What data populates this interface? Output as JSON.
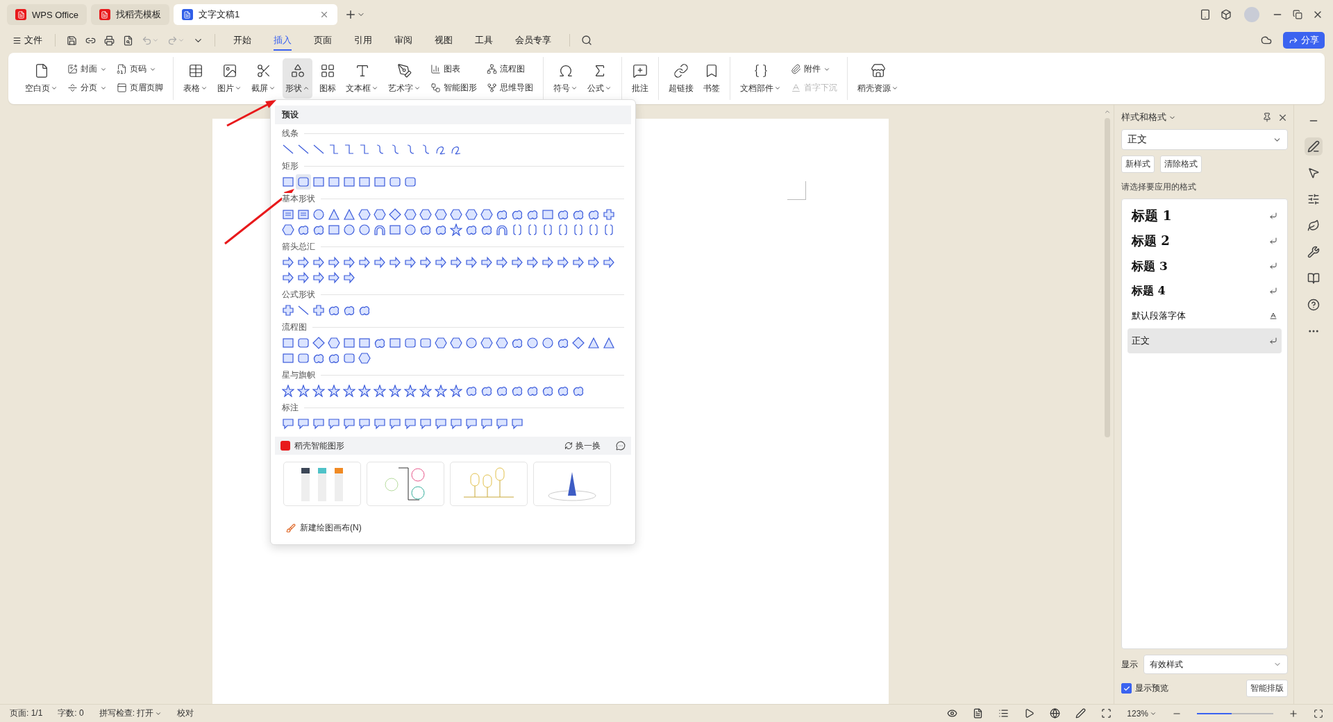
{
  "tabs": [
    {
      "label": "WPS Office",
      "kind": "home",
      "selected": false
    },
    {
      "label": "找稻壳模板",
      "kind": "docer",
      "selected": false
    },
    {
      "label": "文字文稿1",
      "kind": "doc",
      "selected": true
    }
  ],
  "menu": {
    "file": "文件",
    "tabs": [
      {
        "label": "开始",
        "selected": false
      },
      {
        "label": "插入",
        "selected": true
      },
      {
        "label": "页面",
        "selected": false
      },
      {
        "label": "引用",
        "selected": false
      },
      {
        "label": "审阅",
        "selected": false
      },
      {
        "label": "视图",
        "selected": false
      },
      {
        "label": "工具",
        "selected": false
      },
      {
        "label": "会员专享",
        "selected": false
      }
    ],
    "share": "分享"
  },
  "ribbon": [
    {
      "items": [
        {
          "kind": "large",
          "label": "空白页",
          "caret": true,
          "open": false
        },
        {
          "kind": "stack",
          "items": [
            {
              "label": "封面",
              "caret": true,
              "disabled": false
            },
            {
              "label": "分页",
              "caret": true,
              "disabled": false
            }
          ]
        },
        {
          "kind": "stack",
          "items": [
            {
              "label": "页码",
              "caret": true,
              "disabled": false
            },
            {
              "label": "页眉页脚",
              "caret": false,
              "disabled": false
            }
          ]
        }
      ]
    },
    {
      "items": [
        {
          "kind": "large",
          "label": "表格",
          "caret": true,
          "open": false
        },
        {
          "kind": "large",
          "label": "图片",
          "caret": true,
          "open": false
        },
        {
          "kind": "large",
          "label": "截屏",
          "caret": true,
          "open": false
        },
        {
          "kind": "large",
          "label": "形状",
          "caret": true,
          "open": true
        },
        {
          "kind": "large",
          "label": "图标",
          "caret": false,
          "open": false
        },
        {
          "kind": "large",
          "label": "文本框",
          "caret": true,
          "open": false
        },
        {
          "kind": "large",
          "label": "艺术字",
          "caret": true,
          "open": false
        },
        {
          "kind": "stack",
          "items": [
            {
              "label": "图表",
              "caret": false,
              "disabled": false
            },
            {
              "label": "智能图形",
              "caret": false,
              "disabled": false
            }
          ]
        },
        {
          "kind": "stack",
          "items": [
            {
              "label": "流程图",
              "caret": false,
              "disabled": false
            },
            {
              "label": "思维导图",
              "caret": false,
              "disabled": false
            }
          ]
        }
      ]
    },
    {
      "items": [
        {
          "kind": "large",
          "label": "符号",
          "caret": true,
          "open": false
        },
        {
          "kind": "large",
          "label": "公式",
          "caret": true,
          "open": false
        }
      ]
    },
    {
      "items": [
        {
          "kind": "large",
          "label": "批注",
          "caret": false,
          "open": false
        }
      ]
    },
    {
      "items": [
        {
          "kind": "large",
          "label": "超链接",
          "caret": false,
          "open": false
        },
        {
          "kind": "large",
          "label": "书签",
          "caret": false,
          "open": false
        }
      ]
    },
    {
      "items": [
        {
          "kind": "large",
          "label": "文档部件",
          "caret": true,
          "open": false
        },
        {
          "kind": "stack",
          "items": [
            {
              "label": "附件",
              "caret": true,
              "disabled": false
            },
            {
              "label": "首字下沉",
              "caret": false,
              "disabled": true
            }
          ]
        }
      ]
    },
    {
      "items": [
        {
          "kind": "large",
          "label": "稻壳资源",
          "caret": true,
          "open": false
        }
      ]
    }
  ],
  "shape_menu": {
    "title": "预设",
    "sections": [
      {
        "title": "线条",
        "shapes": [
          {
            "selected": false
          },
          {
            "selected": false
          },
          {
            "selected": false
          },
          {
            "selected": false
          },
          {
            "selected": false
          },
          {
            "selected": false
          },
          {
            "selected": false
          },
          {
            "selected": false
          },
          {
            "selected": false
          },
          {
            "selected": false
          },
          {
            "selected": false
          },
          {
            "selected": false
          }
        ]
      },
      {
        "title": "矩形",
        "shapes": [
          {
            "selected": false
          },
          {
            "selected": true
          },
          {
            "selected": false
          },
          {
            "selected": false
          },
          {
            "selected": false
          },
          {
            "selected": false
          },
          {
            "selected": false
          },
          {
            "selected": false
          },
          {
            "selected": false
          }
        ]
      },
      {
        "title": "基本形状",
        "shapes": [
          {
            "selected": false
          },
          {
            "selected": false
          },
          {
            "selected": false
          },
          {
            "selected": false
          },
          {
            "selected": false
          },
          {
            "selected": false
          },
          {
            "selected": false
          },
          {
            "selected": false
          },
          {
            "selected": false
          },
          {
            "selected": false
          },
          {
            "selected": false
          },
          {
            "selected": false
          },
          {
            "selected": false
          },
          {
            "selected": false
          },
          {
            "selected": false
          },
          {
            "selected": false
          },
          {
            "selected": false
          },
          {
            "selected": false
          },
          {
            "selected": false
          },
          {
            "selected": false
          },
          {
            "selected": false
          },
          {
            "selected": false
          },
          {
            "selected": false
          },
          {
            "selected": false
          },
          {
            "selected": false
          },
          {
            "selected": false
          },
          {
            "selected": false
          },
          {
            "selected": false
          },
          {
            "selected": false
          },
          {
            "selected": false
          },
          {
            "selected": false
          },
          {
            "selected": false
          },
          {
            "selected": false
          },
          {
            "selected": false
          },
          {
            "selected": false
          },
          {
            "selected": false
          },
          {
            "selected": false
          },
          {
            "selected": false
          },
          {
            "selected": false
          },
          {
            "selected": false
          },
          {
            "selected": false
          },
          {
            "selected": false
          },
          {
            "selected": false
          },
          {
            "selected": false
          }
        ]
      },
      {
        "title": "箭头总汇",
        "shapes": [
          {
            "selected": false
          },
          {
            "selected": false
          },
          {
            "selected": false
          },
          {
            "selected": false
          },
          {
            "selected": false
          },
          {
            "selected": false
          },
          {
            "selected": false
          },
          {
            "selected": false
          },
          {
            "selected": false
          },
          {
            "selected": false
          },
          {
            "selected": false
          },
          {
            "selected": false
          },
          {
            "selected": false
          },
          {
            "selected": false
          },
          {
            "selected": false
          },
          {
            "selected": false
          },
          {
            "selected": false
          },
          {
            "selected": false
          },
          {
            "selected": false
          },
          {
            "selected": false
          },
          {
            "selected": false
          },
          {
            "selected": false
          },
          {
            "selected": false
          },
          {
            "selected": false
          },
          {
            "selected": false
          },
          {
            "selected": false
          },
          {
            "selected": false
          }
        ]
      },
      {
        "title": "公式形状",
        "shapes": [
          {
            "selected": false
          },
          {
            "selected": false
          },
          {
            "selected": false
          },
          {
            "selected": false
          },
          {
            "selected": false
          },
          {
            "selected": false
          }
        ]
      },
      {
        "title": "流程图",
        "shapes": [
          {
            "selected": false
          },
          {
            "selected": false
          },
          {
            "selected": false
          },
          {
            "selected": false
          },
          {
            "selected": false
          },
          {
            "selected": false
          },
          {
            "selected": false
          },
          {
            "selected": false
          },
          {
            "selected": false
          },
          {
            "selected": false
          },
          {
            "selected": false
          },
          {
            "selected": false
          },
          {
            "selected": false
          },
          {
            "selected": false
          },
          {
            "selected": false
          },
          {
            "selected": false
          },
          {
            "selected": false
          },
          {
            "selected": false
          },
          {
            "selected": false
          },
          {
            "selected": false
          },
          {
            "selected": false
          },
          {
            "selected": false
          },
          {
            "selected": false
          },
          {
            "selected": false
          },
          {
            "selected": false
          },
          {
            "selected": false
          },
          {
            "selected": false
          },
          {
            "selected": false
          }
        ]
      },
      {
        "title": "星与旗帜",
        "shapes": [
          {
            "selected": false
          },
          {
            "selected": false
          },
          {
            "selected": false
          },
          {
            "selected": false
          },
          {
            "selected": false
          },
          {
            "selected": false
          },
          {
            "selected": false
          },
          {
            "selected": false
          },
          {
            "selected": false
          },
          {
            "selected": false
          },
          {
            "selected": false
          },
          {
            "selected": false
          },
          {
            "selected": false
          },
          {
            "selected": false
          },
          {
            "selected": false
          },
          {
            "selected": false
          },
          {
            "selected": false
          },
          {
            "selected": false
          },
          {
            "selected": false
          },
          {
            "selected": false
          }
        ]
      },
      {
        "title": "标注",
        "shapes": [
          {
            "selected": false
          },
          {
            "selected": false
          },
          {
            "selected": false
          },
          {
            "selected": false
          },
          {
            "selected": false
          },
          {
            "selected": false
          },
          {
            "selected": false
          },
          {
            "selected": false
          },
          {
            "selected": false
          },
          {
            "selected": false
          },
          {
            "selected": false
          },
          {
            "selected": false
          },
          {
            "selected": false
          },
          {
            "selected": false
          },
          {
            "selected": false
          },
          {
            "selected": false
          }
        ]
      }
    ],
    "smart": {
      "title": "稻壳智能图形",
      "refresh": "换一换",
      "thumbnails": [
        {
          "kind": "columns"
        },
        {
          "kind": "mindmap"
        },
        {
          "kind": "timeline"
        },
        {
          "kind": "landmark"
        }
      ]
    },
    "new_canvas": "新建绘图画布(N)"
  },
  "styles_panel": {
    "title": "样式和格式",
    "current": "正文",
    "buttons": [
      "新样式",
      "清除格式"
    ],
    "prompt": "请选择要应用的格式",
    "styles": [
      {
        "label": "标题 1",
        "kind": "heading1",
        "selected": false
      },
      {
        "label": "标题 2",
        "kind": "heading2",
        "selected": false
      },
      {
        "label": "标题 3",
        "kind": "heading3",
        "selected": false
      },
      {
        "label": "标题 4",
        "kind": "heading4",
        "selected": false
      },
      {
        "label": "默认段落字体",
        "kind": "character",
        "selected": false
      },
      {
        "label": "正文",
        "kind": "paragraph",
        "selected": true
      }
    ],
    "show_label": "显示",
    "show_value": "有效样式",
    "preview": {
      "label": "显示预览",
      "checked": true
    },
    "smart_button": "智能排版"
  },
  "status_bar": {
    "page": "页面: 1/1",
    "words": "字数: 0",
    "spell": "拼写检查: 打开",
    "proofread": "校对",
    "zoom": "123%",
    "zoom_slider": {
      "level": 0.45
    }
  }
}
